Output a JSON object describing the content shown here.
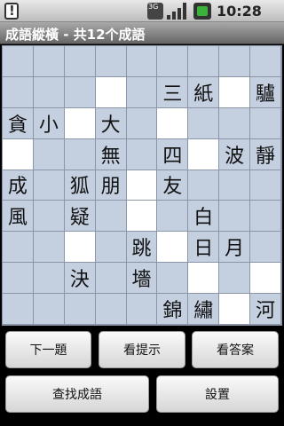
{
  "status": {
    "network": "3G",
    "time": "10:28 AM"
  },
  "app": {
    "title": "成語縱橫 - 共12个成語"
  },
  "grid": {
    "rows": [
      [
        "",
        "",
        "",
        "",
        "",
        "",
        "",
        "",
        ""
      ],
      [
        "",
        "",
        "",
        "W",
        "",
        "三",
        "紙",
        "W",
        "驢"
      ],
      [
        "貪",
        "小",
        "W",
        "大",
        "",
        "W",
        "",
        "",
        ""
      ],
      [
        "W",
        "",
        "",
        "無",
        "",
        "四",
        "W",
        "波",
        "靜"
      ],
      [
        "成",
        "",
        "狐",
        "朋",
        "W",
        "友",
        "",
        "",
        ""
      ],
      [
        "風",
        "",
        "疑",
        "",
        "W",
        "",
        "白",
        "",
        ""
      ],
      [
        "",
        "",
        "W",
        "",
        "跳",
        "W",
        "日",
        "月",
        ""
      ],
      [
        "",
        "",
        "決",
        "",
        "墻",
        "",
        "W",
        "",
        "W"
      ],
      [
        "",
        "",
        "",
        "",
        "",
        "錦",
        "繡",
        "W",
        "河"
      ]
    ]
  },
  "buttons": {
    "next": "下一題",
    "hint": "看提示",
    "answer": "看答案",
    "search": "查找成語",
    "settings": "設置"
  }
}
